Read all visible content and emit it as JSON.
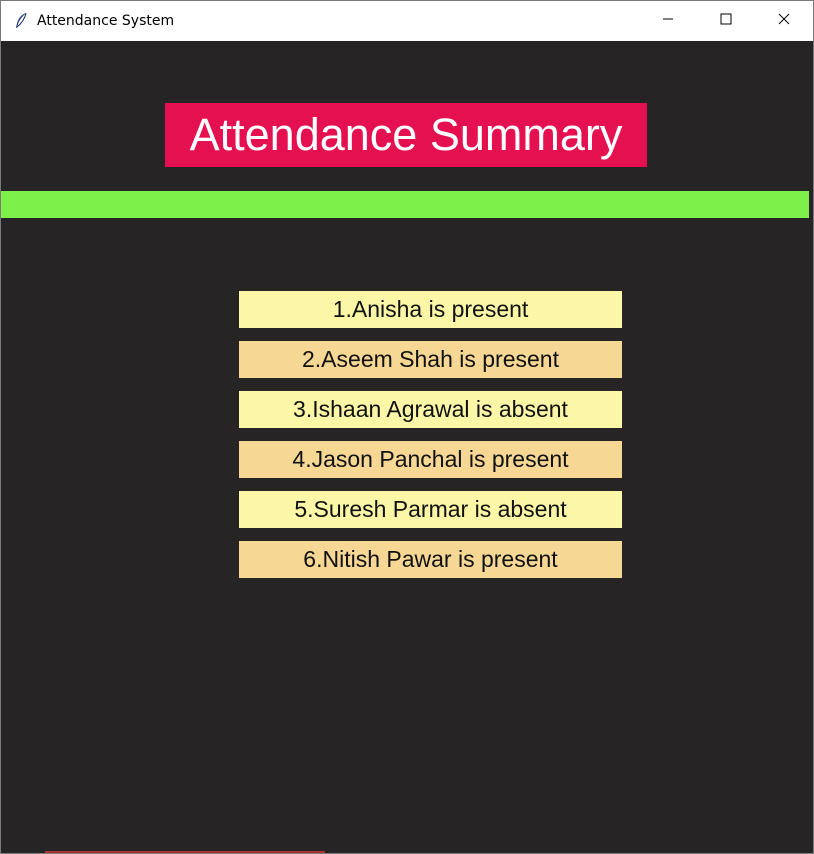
{
  "window": {
    "title": "Attendance System",
    "icon": "feather-icon",
    "controls": [
      "minimize-icon",
      "maximize-icon",
      "close-icon"
    ]
  },
  "colors": {
    "background": "#262424",
    "heading_bg": "#e5104f",
    "divider": "#7ef04a",
    "row_light": "#fbf7a6",
    "row_dark": "#f6d794"
  },
  "summary": {
    "heading": "Attendance Summary",
    "records": [
      "1.Anisha is present",
      "2.Aseem Shah is present",
      "3.Ishaan Agrawal is absent",
      "4.Jason Panchal is present",
      "5.Suresh Parmar is absent",
      "6.Nitish Pawar is present"
    ]
  }
}
